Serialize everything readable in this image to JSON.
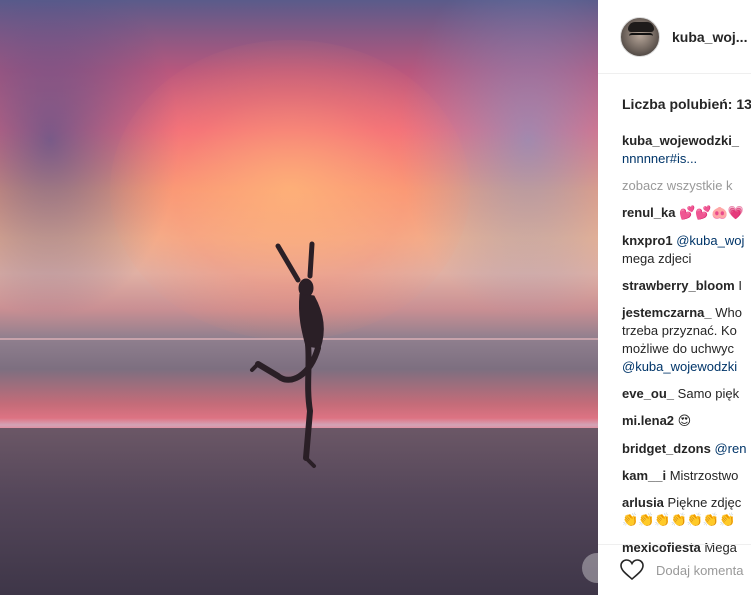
{
  "post": {
    "username": "kuba_woj...",
    "likes_text": "Liczba polubień: 13,"
  },
  "comments": {
    "caption": {
      "user": "kuba_wojewodzki_",
      "text": "nnnnner#is..."
    },
    "see_all": "zobacz wszystkie k",
    "items": [
      {
        "user": "renul_ka",
        "text": "💕💕🐽💗"
      },
      {
        "user": "knxpro1",
        "mention": "@kuba_woj",
        "text2": "mega zdjeci"
      },
      {
        "user": "strawberry_bloom",
        "text": "I"
      },
      {
        "user": "jestemczarna_",
        "text": "Who",
        "line2": "trzeba przyznać. Ko",
        "line3": "możliwe do uchwyc",
        "mention": "@kuba_wojewodzki"
      },
      {
        "user": "eve_ou_",
        "text": "Samo pięk"
      },
      {
        "user": "mi.lena2",
        "text": "😍"
      },
      {
        "user": "bridget_dzons",
        "mention": "@ren"
      },
      {
        "user": "kam__i",
        "text": "Mistrzostwo"
      },
      {
        "user": "arlusia",
        "text": "Piękne zdjęc",
        "line2": "👏👏👏👏👏👏👏"
      },
      {
        "user": "mexicofiesta",
        "text": "Mega"
      }
    ]
  },
  "footer": {
    "add_comment_placeholder": "Dodaj komenta"
  }
}
